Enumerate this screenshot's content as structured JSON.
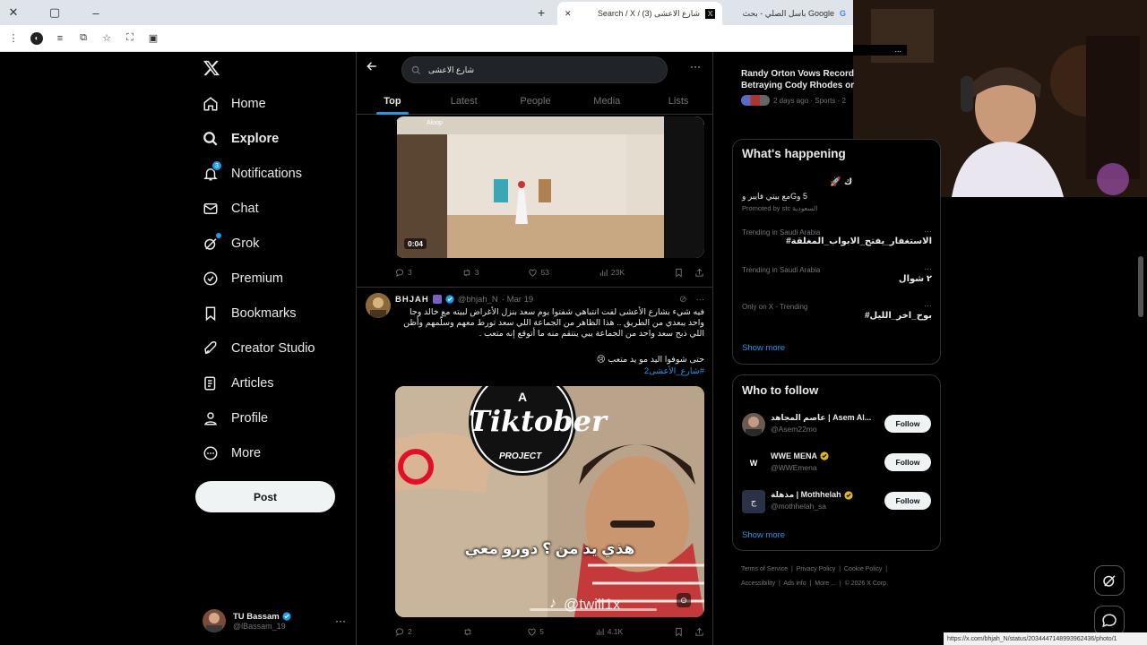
{
  "browser": {
    "tabs": [
      {
        "title": "Search / X / (3) شارع الاعشى"
      },
      {
        "title": "باسل الصلي - بحث Google"
      }
    ],
    "status_url": "https://x.com/bhjah_N/status/2034447148993962436/photo/1"
  },
  "nav": {
    "items": [
      {
        "label": "Home",
        "icon": "home-icon"
      },
      {
        "label": "Explore",
        "icon": "search-icon"
      },
      {
        "label": "Notifications",
        "icon": "bell-icon"
      },
      {
        "label": "Chat",
        "icon": "mail-icon"
      },
      {
        "label": "Grok",
        "icon": "grok-icon"
      },
      {
        "label": "Premium",
        "icon": "premium-icon"
      },
      {
        "label": "Bookmarks",
        "icon": "bookmark-icon"
      },
      {
        "label": "Creator Studio",
        "icon": "rocket-icon"
      },
      {
        "label": "Articles",
        "icon": "article-icon"
      },
      {
        "label": "Profile",
        "icon": "person-icon"
      },
      {
        "label": "More",
        "icon": "more-circle-icon"
      }
    ],
    "notifications_badge": "3",
    "post_label": "Post",
    "user": {
      "name": "TU Bassam",
      "handle": "@lBassam_19"
    }
  },
  "search": {
    "query": "شارع الاعشى",
    "tabs": [
      "Top",
      "Latest",
      "People",
      "Media",
      "Lists"
    ],
    "active_tab": "Top"
  },
  "tweet1": {
    "video_time": "0:04",
    "watermark": "Aloop",
    "replies": "3",
    "reposts": "3",
    "likes": "53",
    "views": "23K"
  },
  "tweet2": {
    "name": "BHJAH",
    "handle": "@bhjah_N",
    "date": "· Mar 19",
    "text": "فيه شيء بشارع الأعشى لفت انتباهي شفتوا يوم سعد بنزل الأغراض لبيته مع خالد وجا واحد يبعدي من الطريق .. هذا الظاهر من الجماعة اللي سعد تورط معهم وسلّمهم وأظن اللي ذبح سعد واحد من الجماعة يبي ينتقم منه ما أتوقع إنه متعب .",
    "text2": "حتى شوفوا اليد مو يد متعب 😢",
    "hashtag": "#شارع_الأعشى2",
    "overlay_title": "Tiktober",
    "overlay_top": "A",
    "overlay_bottom": "PROJECT",
    "subtitle": "هذي يد من ؟ دورو معي",
    "tiktok": "@twiii1x",
    "replies": "2",
    "reposts": "",
    "likes": "5",
    "views": "4.1K"
  },
  "sidebar": {
    "news": {
      "title": "Randy Orton Vows Record Betraying Cody Rhodes or",
      "meta": "2 days ago · Sports · 2"
    },
    "happening": {
      "title": "What's happening",
      "promo_line1": "5 وGمع بيتي فايبر و",
      "promo_by": "Promoted by stc السعودية",
      "trends": [
        {
          "context": "Trending in Saudi Arabia",
          "name": "#الاستغفار_يفتح_الابواب_المغلقة"
        },
        {
          "context": "Trending in Saudi Arabia",
          "name": "٢ شوال"
        },
        {
          "context": "Only on X · Trending",
          "name": "#بوح_اخر_الليل"
        }
      ],
      "show_more": "Show more"
    },
    "who_to_follow": {
      "title": "Who to follow",
      "accounts": [
        {
          "name": "عاصم المجاهد | Asem Al...",
          "handle": "@Asem22mo"
        },
        {
          "name": "WWE MENA",
          "handle": "@WWEmena"
        },
        {
          "name": "مذهلة | Mothhelah",
          "handle": "@mothhelah_sa"
        }
      ],
      "follow_label": "Follow",
      "show_more": "Show more"
    },
    "footer": [
      "Terms of Service",
      "Privacy Policy",
      "Cookie Policy",
      "Accessibility",
      "Ads info",
      "More ...",
      "© 2026 X Corp."
    ]
  },
  "colors": {
    "accent": "#1d9bf0",
    "bg": "#000000",
    "text": "#e7e9ea",
    "muted": "#71767b"
  }
}
